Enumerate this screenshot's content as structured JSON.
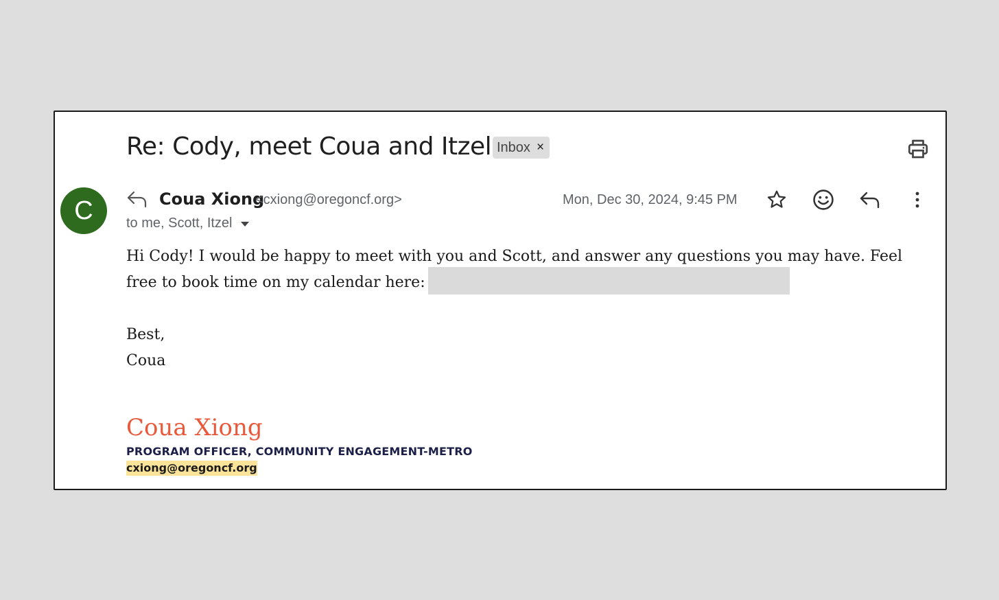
{
  "email": {
    "subject": "Re: Cody, meet Coua and Itzel!",
    "label": "Inbox",
    "label_remove_glyph": "×",
    "colors": {
      "avatar_bg": "#2e6b1f",
      "signature_name": "#e8593b",
      "signature_title": "#1c2048",
      "email_highlight": "#fbe49a"
    }
  },
  "sender": {
    "avatar_letter": "C",
    "name": "Coua Xiong",
    "email": "<cxiong@oregoncf.org>",
    "recipients": "to me, Scott, Itzel",
    "datetime": "Mon, Dec 30, 2024, 9:45 PM"
  },
  "icons": {
    "print": "print-icon",
    "reply_indicator": "reply-icon",
    "star": "star-icon",
    "emoji": "emoji-reaction-icon",
    "reply": "reply-icon",
    "more": "more-vert-icon",
    "recipients_caret": "caret-down-icon"
  },
  "body": {
    "paragraph": "Hi Cody! I would be happy to meet with you and Scott, and answer any questions you may have. Feel free to book time on my calendar here:",
    "closing": "Best,",
    "closing_name": "Coua"
  },
  "signature": {
    "name": "Coua Xiong",
    "title": "PROGRAM OFFICER, COMMUNITY ENGAGEMENT-METRO",
    "email": "cxiong@oregoncf.org"
  }
}
